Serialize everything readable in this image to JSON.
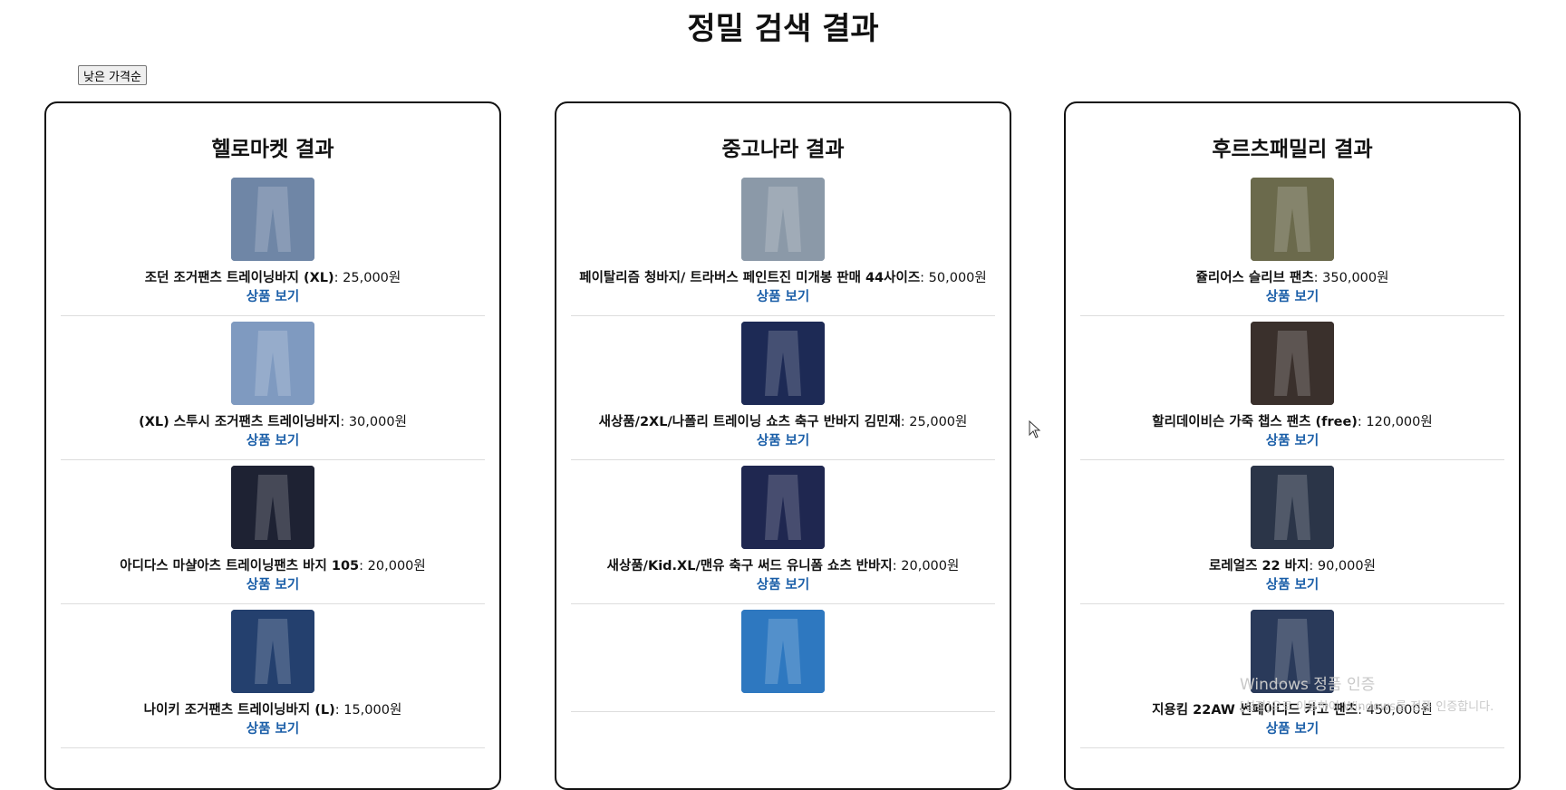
{
  "page": {
    "title": "정밀 검색 결과",
    "sort_button_label": "낮은 가격순",
    "link_label": "상품 보기"
  },
  "panels": [
    {
      "title": "헬로마켓 결과",
      "items": [
        {
          "title": "조던 조거팬츠 트레이닝바지 (XL)",
          "price": "25,000원",
          "thumb_color": "#6f86a6"
        },
        {
          "title": "(XL) 스투시 조거팬츠 트레이닝바지",
          "price": "30,000원",
          "thumb_color": "#7f9ac0"
        },
        {
          "title": "아디다스 마샬아츠 트레이닝팬츠 바지 105",
          "price": "20,000원",
          "thumb_color": "#1e2233"
        },
        {
          "title": "나이키 조거팬츠 트레이닝바지 (L)",
          "price": "15,000원",
          "thumb_color": "#24406e"
        }
      ]
    },
    {
      "title": "중고나라 결과",
      "items": [
        {
          "title": "페이탈리즘 청바지/ 트라버스 페인트진 미개봉 판매 44사이즈",
          "price": "50,000원",
          "thumb_color": "#8b99a8"
        },
        {
          "title": "새상품/2XL/나폴리 트레이닝 쇼츠 축구 반바지 김민재",
          "price": "25,000원",
          "thumb_color": "#1d2a55"
        },
        {
          "title": "새상품/Kid.XL/맨유 축구 써드 유니폼 쇼츠 반바지",
          "price": "20,000원",
          "thumb_color": "#1f2750"
        },
        {
          "title": "",
          "price": "",
          "thumb_color": "#2e78c0"
        }
      ]
    },
    {
      "title": "후르츠패밀리 결과",
      "items": [
        {
          "title": "쥴리어스 슬리브 팬츠",
          "price": "350,000원",
          "thumb_color": "#6b6a4c"
        },
        {
          "title": "할리데이비슨 가죽 챕스 팬츠 (free)",
          "price": "120,000원",
          "thumb_color": "#3a302c"
        },
        {
          "title": "로레얼즈 22 바지",
          "price": "90,000원",
          "thumb_color": "#2b3548"
        },
        {
          "title": "지용킴 22AW 썬페이디드 카고 팬츠",
          "price": "450,000원",
          "thumb_color": "#2a3a5a"
        }
      ]
    }
  ],
  "watermark": {
    "line1": "Windows 정품 인증",
    "line2": "[설정]으로 이동하여 Windows를 정품 인증합니다."
  }
}
